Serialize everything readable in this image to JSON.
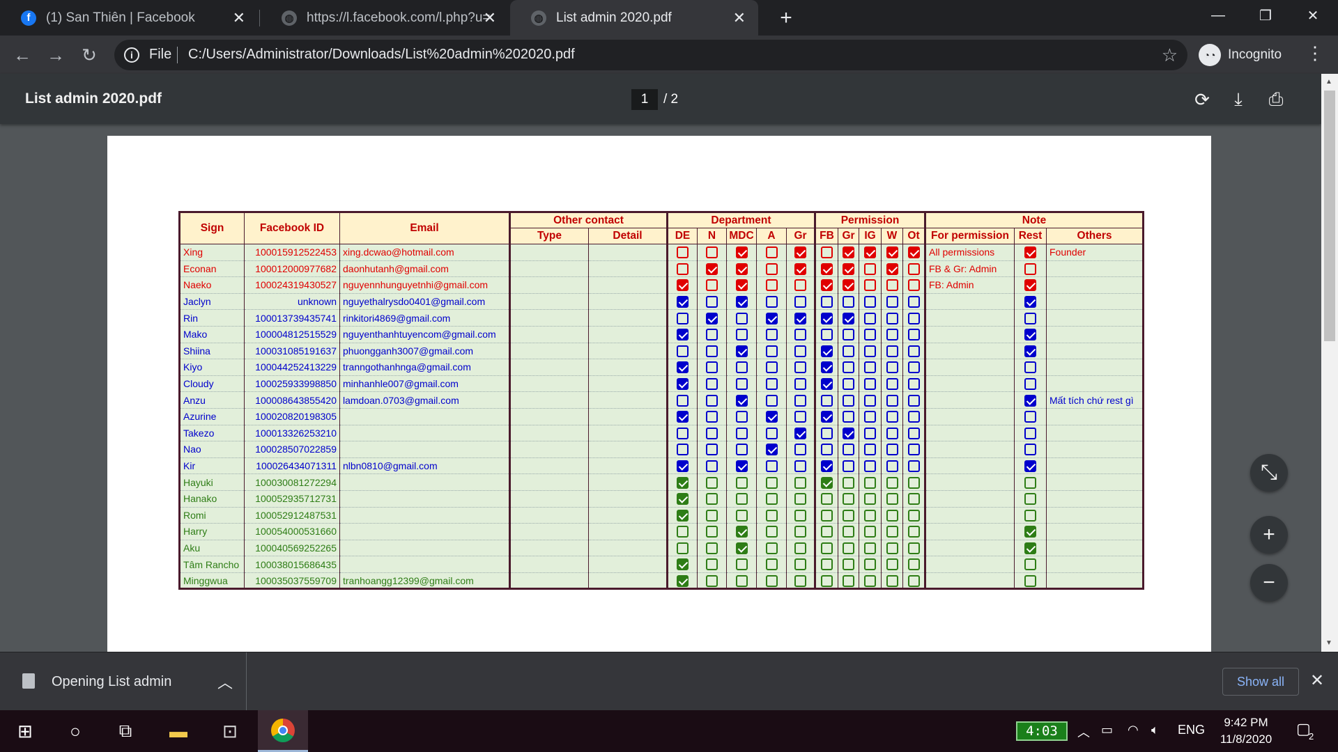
{
  "tabs": [
    {
      "title": "(1) San Thiên | Facebook",
      "icon": "facebook-icon"
    },
    {
      "title": "https://l.facebook.com/l.php?u=",
      "icon": "globe-icon"
    },
    {
      "title": "List admin 2020.pdf",
      "icon": "globe-icon"
    }
  ],
  "toolbar": {
    "scheme": "File",
    "url": "C:/Users/Administrator/Downloads/List%20admin%202020.pdf",
    "profile": "Incognito"
  },
  "pdf": {
    "title": "List admin 2020.pdf",
    "page_current": "1",
    "page_total": "/  2"
  },
  "sheet": {
    "headers": {
      "sign": "Sign",
      "facebook_id": "Facebook ID",
      "email": "Email",
      "other_contact": "Other contact",
      "type": "Type",
      "detail": "Detail",
      "department": "Department",
      "permission": "Permission",
      "note": "Note",
      "dept_cols": [
        "DE",
        "N",
        "MDC",
        "A",
        "Gr"
      ],
      "perm_cols": [
        "FB",
        "Gr",
        "IG",
        "W",
        "Ot"
      ],
      "for_permission": "For permission",
      "rest": "Rest",
      "others": "Others"
    },
    "rows": [
      {
        "sign": "Xing",
        "fbid": "100015912522453",
        "email": "xing.dcwao@hotmail.com",
        "color": "red",
        "dept": [
          0,
          0,
          1,
          0,
          1
        ],
        "perm": [
          0,
          1,
          1,
          1,
          1
        ],
        "for_perm": "All permissions",
        "rest": 1,
        "others": "Founder"
      },
      {
        "sign": "Econan",
        "fbid": "100012000977682",
        "email": "daonhutanh@gmail.com",
        "color": "red",
        "dept": [
          0,
          1,
          1,
          0,
          1
        ],
        "perm": [
          1,
          1,
          0,
          1,
          0
        ],
        "for_perm": "FB & Gr: Admin",
        "rest": 0,
        "others": ""
      },
      {
        "sign": "Naeko",
        "fbid": "100024319430527",
        "email": "nguyennhunguyetnhi@gmail.com",
        "color": "red",
        "dept": [
          1,
          0,
          1,
          0,
          0
        ],
        "perm": [
          1,
          1,
          0,
          0,
          0
        ],
        "for_perm": "FB: Admin",
        "rest": 1,
        "others": ""
      },
      {
        "sign": "Jaclyn",
        "fbid": "unknown",
        "email": "nguyethalrysdo0401@gmail.com",
        "color": "blue",
        "dept": [
          1,
          0,
          1,
          0,
          0
        ],
        "perm": [
          0,
          0,
          0,
          0,
          0
        ],
        "for_perm": "",
        "rest": 1,
        "others": ""
      },
      {
        "sign": "Rin",
        "fbid": "100013739435741",
        "email": "rinkitori4869@gmail.com",
        "color": "blue",
        "dept": [
          0,
          1,
          0,
          1,
          1
        ],
        "perm": [
          1,
          1,
          0,
          0,
          0
        ],
        "for_perm": "",
        "rest": 0,
        "others": ""
      },
      {
        "sign": "Mako",
        "fbid": "100004812515529",
        "email": "nguyenthanhtuyencom@gmail.com",
        "color": "blue",
        "dept": [
          1,
          0,
          0,
          0,
          0
        ],
        "perm": [
          0,
          0,
          0,
          0,
          0
        ],
        "for_perm": "",
        "rest": 1,
        "others": ""
      },
      {
        "sign": "Shiina",
        "fbid": "100031085191637",
        "email": "phuongganh3007@gmail.com",
        "color": "blue",
        "dept": [
          0,
          0,
          1,
          0,
          0
        ],
        "perm": [
          1,
          0,
          0,
          0,
          0
        ],
        "for_perm": "",
        "rest": 1,
        "others": ""
      },
      {
        "sign": "Kiyo",
        "fbid": "100044252413229",
        "email": "tranngothanhnga@gmail.com",
        "color": "blue",
        "dept": [
          1,
          0,
          0,
          0,
          0
        ],
        "perm": [
          1,
          0,
          0,
          0,
          0
        ],
        "for_perm": "",
        "rest": 0,
        "others": ""
      },
      {
        "sign": "Cloudy",
        "fbid": "100025933998850",
        "email": "minhanhle007@gmail.com",
        "color": "blue",
        "dept": [
          1,
          0,
          0,
          0,
          0
        ],
        "perm": [
          1,
          0,
          0,
          0,
          0
        ],
        "for_perm": "",
        "rest": 0,
        "others": ""
      },
      {
        "sign": "Anzu",
        "fbid": "100008643855420",
        "email": "lamdoan.0703@gmail.com",
        "color": "blue",
        "dept": [
          0,
          0,
          1,
          0,
          0
        ],
        "perm": [
          0,
          0,
          0,
          0,
          0
        ],
        "for_perm": "",
        "rest": 1,
        "others": "Mất tích chứ rest gì"
      },
      {
        "sign": "Azurine",
        "fbid": "100020820198305",
        "email": "",
        "color": "blue",
        "dept": [
          1,
          0,
          0,
          1,
          0
        ],
        "perm": [
          1,
          0,
          0,
          0,
          0
        ],
        "for_perm": "",
        "rest": 0,
        "others": ""
      },
      {
        "sign": "Takezo",
        "fbid": "100013326253210",
        "email": "",
        "color": "blue",
        "dept": [
          0,
          0,
          0,
          0,
          1
        ],
        "perm": [
          0,
          1,
          0,
          0,
          0
        ],
        "for_perm": "",
        "rest": 0,
        "others": ""
      },
      {
        "sign": "Nao",
        "fbid": "100028507022859",
        "email": "",
        "color": "blue",
        "dept": [
          0,
          0,
          0,
          1,
          0
        ],
        "perm": [
          0,
          0,
          0,
          0,
          0
        ],
        "for_perm": "",
        "rest": 0,
        "others": ""
      },
      {
        "sign": "Kir",
        "fbid": "100026434071311",
        "email": "nlbn0810@gmail.com",
        "color": "blue",
        "dept": [
          1,
          0,
          1,
          0,
          0
        ],
        "perm": [
          1,
          0,
          0,
          0,
          0
        ],
        "for_perm": "",
        "rest": 1,
        "others": ""
      },
      {
        "sign": "Hayuki",
        "fbid": "100030081272294",
        "email": "",
        "color": "green",
        "dept": [
          1,
          0,
          0,
          0,
          0
        ],
        "perm": [
          1,
          0,
          0,
          0,
          0
        ],
        "for_perm": "",
        "rest": 0,
        "others": ""
      },
      {
        "sign": "Hanako",
        "fbid": "100052935712731",
        "email": "",
        "color": "green",
        "dept": [
          1,
          0,
          0,
          0,
          0
        ],
        "perm": [
          0,
          0,
          0,
          0,
          0
        ],
        "for_perm": "",
        "rest": 0,
        "others": ""
      },
      {
        "sign": "Romi",
        "fbid": "100052912487531",
        "email": "",
        "color": "green",
        "dept": [
          1,
          0,
          0,
          0,
          0
        ],
        "perm": [
          0,
          0,
          0,
          0,
          0
        ],
        "for_perm": "",
        "rest": 0,
        "others": ""
      },
      {
        "sign": "Harry",
        "fbid": "100054000531660",
        "email": "",
        "color": "green",
        "dept": [
          0,
          0,
          1,
          0,
          0
        ],
        "perm": [
          0,
          0,
          0,
          0,
          0
        ],
        "for_perm": "",
        "rest": 1,
        "others": ""
      },
      {
        "sign": "Aku",
        "fbid": "100040569252265",
        "email": "",
        "color": "green",
        "dept": [
          0,
          0,
          1,
          0,
          0
        ],
        "perm": [
          0,
          0,
          0,
          0,
          0
        ],
        "for_perm": "",
        "rest": 1,
        "others": ""
      },
      {
        "sign": "Tâm Rancho",
        "fbid": "100038015686435",
        "email": "",
        "color": "green",
        "dept": [
          1,
          0,
          0,
          0,
          0
        ],
        "perm": [
          0,
          0,
          0,
          0,
          0
        ],
        "for_perm": "",
        "rest": 0,
        "others": ""
      },
      {
        "sign": "Minggwua",
        "fbid": "100035037559709",
        "email": "tranhoangg12399@gmail.com",
        "color": "green",
        "dept": [
          1,
          0,
          0,
          0,
          0
        ],
        "perm": [
          0,
          0,
          0,
          0,
          0
        ],
        "for_perm": "",
        "rest": 0,
        "others": ""
      }
    ]
  },
  "download_shelf": {
    "item_label": "Opening List admin",
    "show_all": "Show all"
  },
  "taskbar": {
    "battery_time": "4:03",
    "language": "ENG",
    "time": "9:42 PM",
    "date": "11/8/2020",
    "notification_count": "2"
  },
  "colors": {
    "red": "#e00000",
    "blue": "#0000cc",
    "green": "#2e7d16",
    "sheet_header_bg": "#fff2cc",
    "sheet_body_bg": "#e2efda"
  }
}
